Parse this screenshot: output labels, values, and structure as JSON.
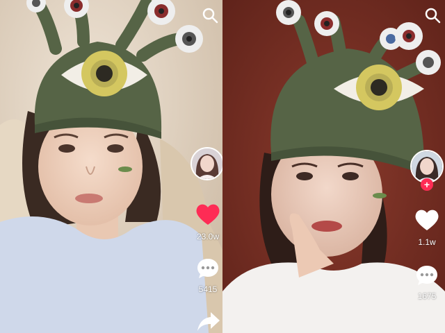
{
  "left": {
    "like_count": "23.0w",
    "comment_count": "5415",
    "liked": true
  },
  "right": {
    "like_count": "1.1w",
    "comment_count": "1675",
    "liked": false,
    "follow_label": "+"
  },
  "icons": {
    "search": "search-icon",
    "like": "heart-icon",
    "comment": "comment-icon",
    "share": "share-icon"
  },
  "colors": {
    "liked_heart": "#fe2c55",
    "hat_green": "#4f5e42",
    "eye_yellow": "#d4c760"
  }
}
